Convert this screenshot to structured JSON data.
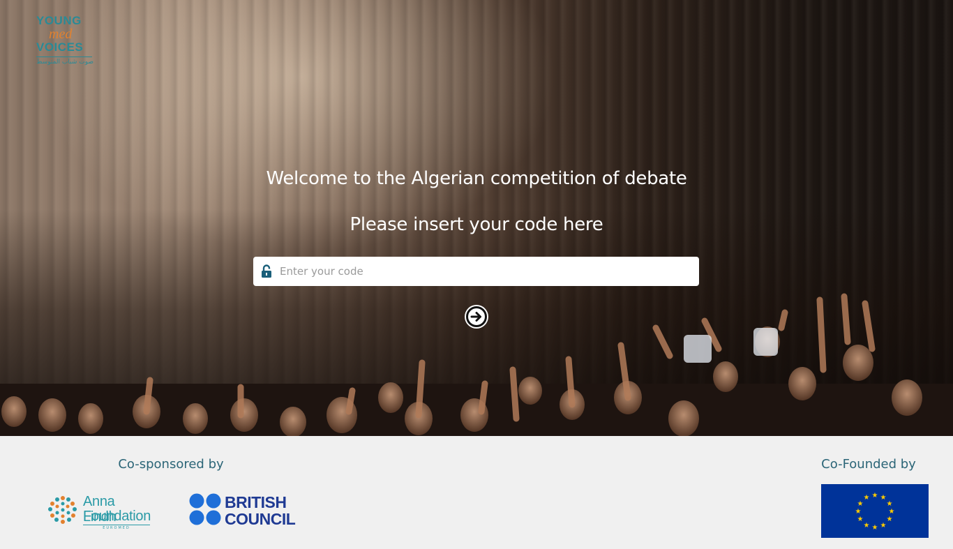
{
  "brand": {
    "line1": "YOUNG",
    "line2": "med",
    "line3": "VOICES",
    "arabic": "صوت شباب المتوسط"
  },
  "hero": {
    "welcome_text": "Welcome to the Algerian competition of debate",
    "instruction_text": "Please insert your code here"
  },
  "code_input": {
    "placeholder": "Enter your code",
    "value": "",
    "icon": "unlock-icon"
  },
  "submit": {
    "icon": "arrow-right-circle-icon"
  },
  "footer": {
    "cosponsored_label": "Co-sponsored by",
    "cofounded_label": "Co-Founded by",
    "sponsors": [
      {
        "name_line1": "Anna Lindh",
        "name_line2": "Foundation",
        "tagline": "EUROMED"
      },
      {
        "name_line1": "BRITISH",
        "name_line2": "COUNCIL"
      }
    ]
  },
  "colors": {
    "brand_teal": "#2a8a96",
    "brand_orange": "#e2812e",
    "footer_text": "#2b6577",
    "british_council_blue": "#1f3a93",
    "eu_blue": "#003399",
    "eu_gold": "#ffcc00"
  }
}
